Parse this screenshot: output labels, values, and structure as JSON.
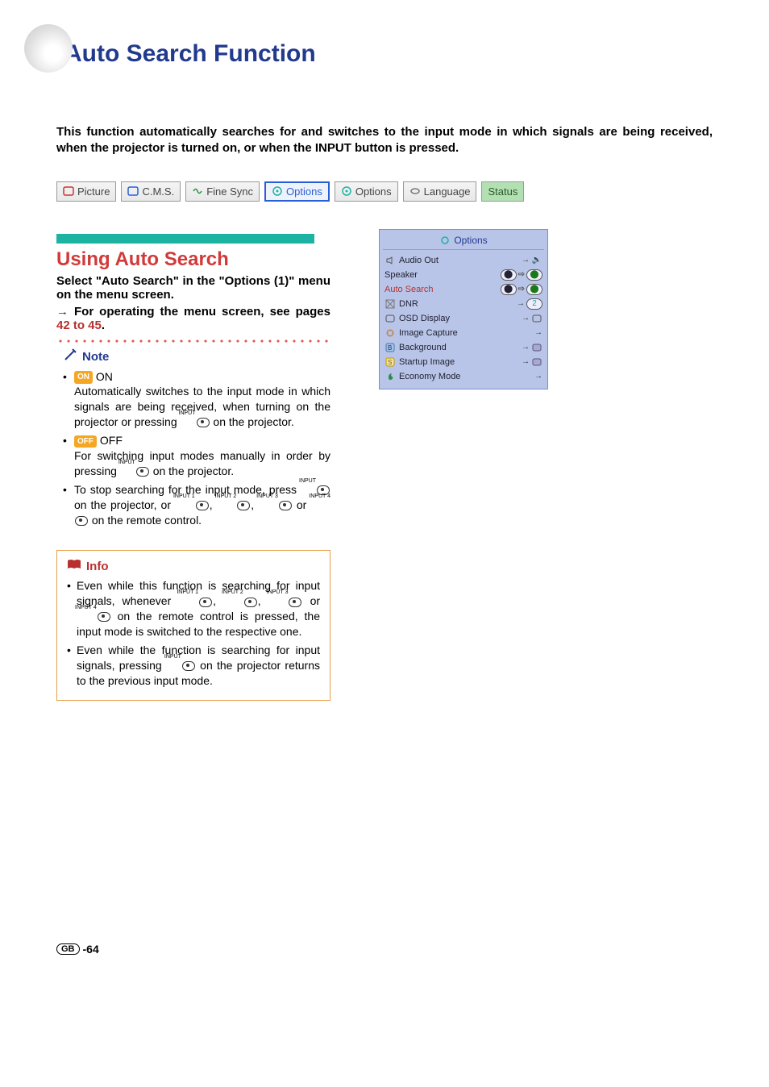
{
  "page_title": "Auto Search Function",
  "intro": "This function automatically searches for and switches to the input mode in which signals are being received, when the projector is turned on, or when the INPUT button is pressed.",
  "tabs": {
    "picture": "Picture",
    "cms": "C.M.S.",
    "finesync": "Fine Sync",
    "options1": "Options",
    "options2": "Options",
    "language": "Language",
    "status": "Status"
  },
  "section": {
    "heading": "Using Auto Search",
    "select_text": "Select \"Auto Search\" in the \"Options (1)\" menu on the menu screen.",
    "operate_prefix": "→ ",
    "operate_text": "For operating the menu screen, see pages ",
    "operate_link": "42 to 45",
    "operate_suffix": "."
  },
  "note": {
    "label": "Note",
    "on_badge": "ON",
    "on_label": "ON",
    "on_text": "Automatically switches to the input mode in which signals are being received, when turning on the projector or pressing ",
    "on_text2": " on the projector.",
    "off_badge": "OFF",
    "off_label": "OFF",
    "off_text": "For switching input modes manually in order by pressing ",
    "off_text2": " on the projector.",
    "stop_text_a": "To stop searching for the input mode, press ",
    "stop_text_b": " on the projector, or ",
    "stop_text_c": " or ",
    "stop_text_d": " on the remote control.",
    "inputs": {
      "i1": "INPUT 1",
      "i2": "INPUT 2",
      "i3": "INPUT 3",
      "i4": "INPUT 4",
      "inp": "INPUT"
    }
  },
  "info": {
    "label": "Info",
    "bullet1_a": "Even while this function is searching for input signals, whenever ",
    "bullet1_b": " or ",
    "bullet1_c": " on the remote control is pressed, the input mode is switched to the respective one.",
    "bullet2_a": "Even while the function is searching for input signals, pressing ",
    "bullet2_b": " on the projector returns to the previous input mode."
  },
  "options_panel": {
    "title": "Options",
    "rows": {
      "audio_out": "Audio Out",
      "speaker": "Speaker",
      "auto_search": "Auto Search",
      "dnr": "DNR",
      "osd": "OSD Display",
      "image_capture": "Image Capture",
      "background": "Background",
      "startup": "Startup Image",
      "economy": "Economy Mode"
    }
  },
  "page_number": {
    "gb": "GB",
    "num": "-64"
  }
}
